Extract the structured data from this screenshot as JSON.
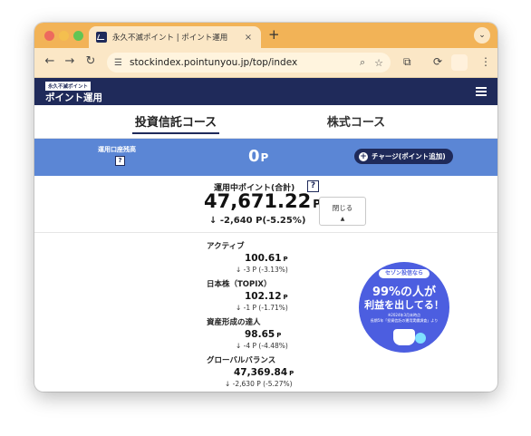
{
  "browser": {
    "tab_title": "永久不滅ポイント | ポイント運用",
    "tab_close": "×",
    "new_tab": "+",
    "tab_menu": "⌄",
    "url": "stockindex.pointunyou.jp/top/index"
  },
  "site": {
    "logo_small": "永久不滅ポイント",
    "logo_main": "ポイント運用"
  },
  "course_tabs": [
    {
      "label": "投資信託コース",
      "active": true
    },
    {
      "label": "株式コース",
      "active": false
    }
  ],
  "balance": {
    "label": "運用口座残高",
    "help": "?",
    "value": "0",
    "unit": "P",
    "charge_button": "チャージ(ポイント追加)"
  },
  "summary": {
    "label": "運用中ポイント(合計)",
    "help": "?",
    "total": "47,671.22",
    "unit": "P",
    "change": "↓ -2,640 P(-5.25%)",
    "close_button": "閉じる",
    "close_caret": "▲"
  },
  "funds": [
    {
      "name": "アクティブ",
      "value": "100.61",
      "unit": "P",
      "change": "↓ -3 P (-3.13%)"
    },
    {
      "name": "日本株（TOPIX）",
      "value": "102.12",
      "unit": "P",
      "change": "↓ -1 P (-1.71%)"
    },
    {
      "name": "資産形成の達人",
      "value": "98.65",
      "unit": "P",
      "change": "↓ -4 P (-4.48%)"
    },
    {
      "name": "グローバルバランス",
      "value": "47,369.84",
      "unit": "P",
      "change": "↓ -2,630 P (-5.27%)"
    }
  ],
  "ad": {
    "pill": "セゾン投信なら",
    "line1": "99%の人が",
    "line2": "利益を出してる！",
    "note1": "※2024年3月末時点",
    "note2": "長期5年「投資信託の運用実績調査」より"
  },
  "colors": {
    "navy": "#1f2a5a",
    "balance_bar": "#5b86d5",
    "tab_strip": "#f2b357",
    "ad_bg": "#4c5ee0"
  }
}
